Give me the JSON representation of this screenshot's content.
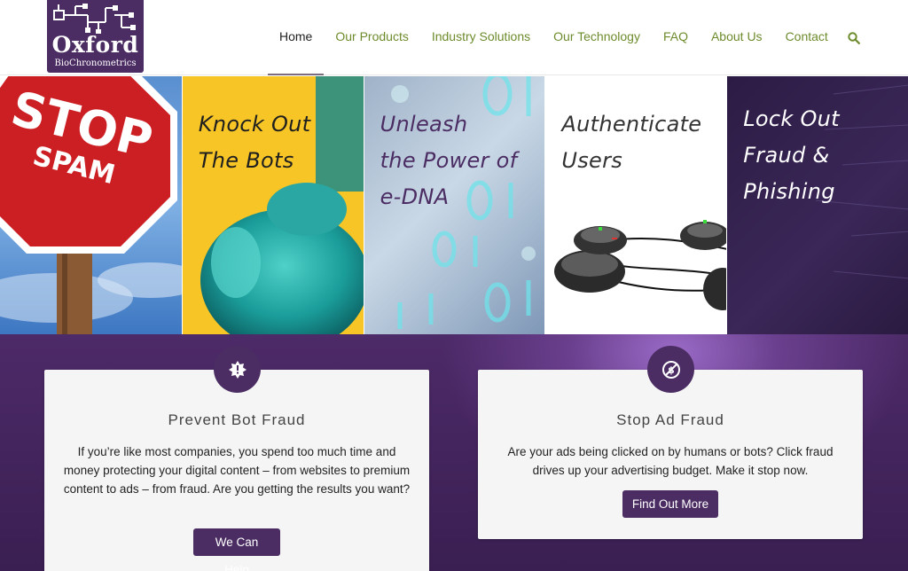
{
  "logo": {
    "word": "Oxford",
    "sub": "BioChronometrics"
  },
  "nav": {
    "items": [
      "Home",
      "Our Products",
      "Industry Solutions",
      "Our Technology",
      "FAQ",
      "About Us",
      "Contact"
    ],
    "active": "Home",
    "search_icon": "search-icon"
  },
  "banner": {
    "panels": [
      {
        "image": "stop-spam-sign",
        "sign_word1": "STOP",
        "sign_word2": "SPAM",
        "lines": []
      },
      {
        "image": "robot-toy-blur",
        "lines": [
          "Knock Out",
          "The Bots"
        ]
      },
      {
        "image": "binary-digits",
        "lines": [
          "Unleash",
          "the Power of",
          "e-DNA"
        ]
      },
      {
        "image": "robots-connected",
        "lines": [
          "Authenticate",
          "Users"
        ]
      },
      {
        "image": "dark-tech-lines",
        "lines": [
          "Lock Out",
          "Fraud &",
          "Phishing"
        ]
      }
    ]
  },
  "cards": [
    {
      "icon": "bug-badge-icon",
      "title": "Prevent Bot Fraud",
      "body": "If you’re like most companies, you spend too much time and money protecting your digital content – from websites to premium content to ads – from fraud. Are you getting the results you want?",
      "button": "We Can Help"
    },
    {
      "icon": "no-dollar-icon",
      "title": "Stop Ad Fraud",
      "body": "Are your ads being clicked on by humans or bots? Click fraud drives up your advertising budget. Make it stop now.",
      "button": "Find Out More"
    }
  ],
  "colors": {
    "brand_purple": "#4b2d63",
    "nav_green": "#6d8b2c",
    "yellow": "#f7c526"
  }
}
